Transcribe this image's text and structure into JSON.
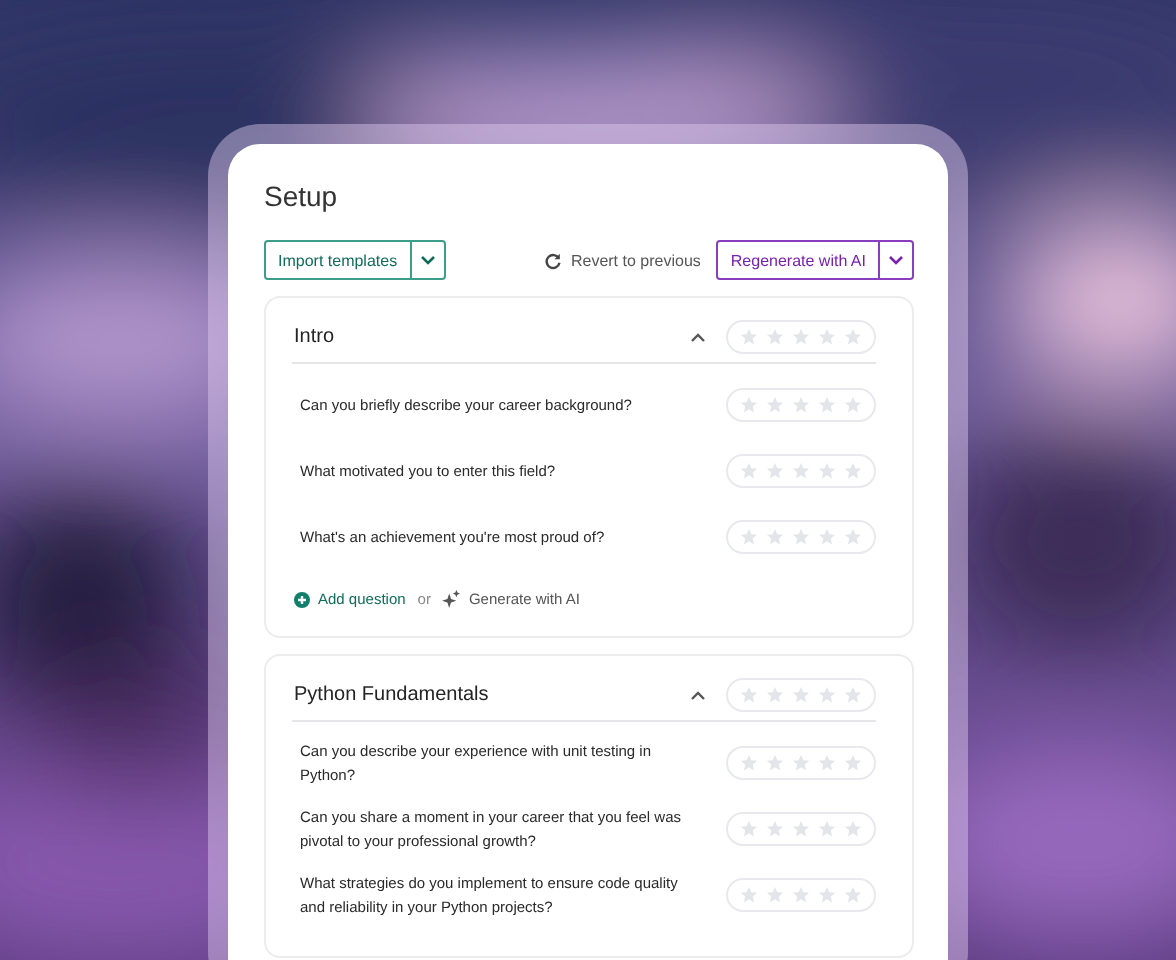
{
  "title": "Setup",
  "toolbar": {
    "import_button": "Import templates",
    "revert_button": "Revert to previous",
    "regenerate_button": "Regenerate with AI"
  },
  "sections": [
    {
      "title": "Intro",
      "expanded": true,
      "stars": 0,
      "questions": [
        {
          "text": "Can you briefly describe your career background?",
          "stars": 0
        },
        {
          "text": "What motivated you to enter this field?",
          "stars": 0
        },
        {
          "text": "What's an achievement you're most proud of?",
          "stars": 0
        }
      ],
      "add_question": "Add question",
      "or_text": "or",
      "generate_link": "Generate with AI"
    },
    {
      "title": "Python Fundamentals",
      "expanded": true,
      "stars": 0,
      "questions": [
        {
          "text": "Can you describe your experience with unit testing in Python?",
          "stars": 0
        },
        {
          "text": "Can you share a moment in your career that you feel was pivotal to your professional growth?",
          "stars": 0
        },
        {
          "text": "What strategies do you implement to ensure code quality and reliability in your Python projects?",
          "stars": 0
        }
      ]
    }
  ]
}
